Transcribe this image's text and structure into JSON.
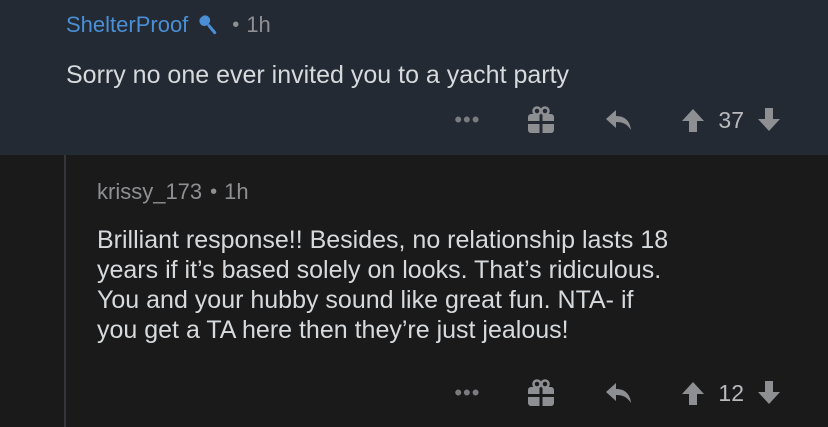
{
  "comments": [
    {
      "username": "ShelterProof",
      "separator": "•",
      "time": "1h",
      "body": "Sorry no one ever invited you to a yacht party",
      "more_label": "•••",
      "score": "37",
      "username_color": "#4a8fd6",
      "flair_icon": "microphone-icon"
    },
    {
      "username": "krissy_173",
      "separator": "•",
      "time": "1h",
      "body": "Brilliant response!! Besides, no relationship lasts 18\nyears if it’s based solely on looks. That’s ridiculous.\nYou and your hubby sound like great fun. NTA- if\nyou get a TA here then they’re just jealous!",
      "more_label": "•••",
      "score": "12",
      "username_color": "#8e8f92"
    }
  ]
}
